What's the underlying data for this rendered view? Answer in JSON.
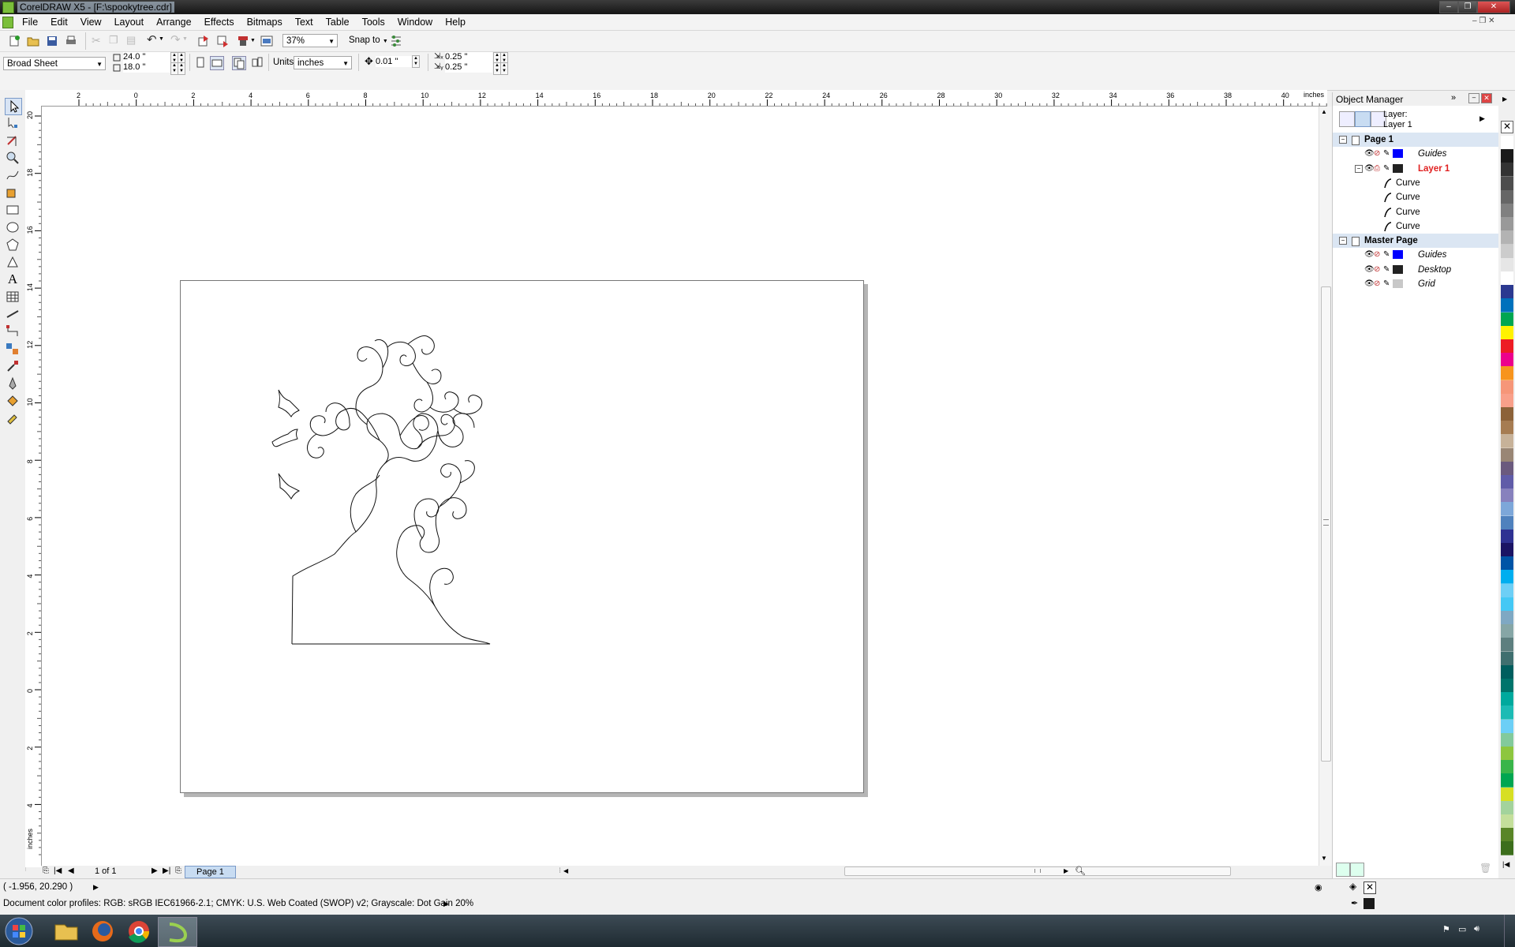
{
  "window": {
    "title": "CorelDRAW X5 - [F:\\spookytree.cdr]"
  },
  "menu": [
    "File",
    "Edit",
    "View",
    "Layout",
    "Arrange",
    "Effects",
    "Bitmaps",
    "Text",
    "Table",
    "Tools",
    "Window",
    "Help"
  ],
  "standard_toolbar": {
    "zoom": "37%",
    "snap_label": "Snap to"
  },
  "property_bar": {
    "paper_type": "Broad Sheet",
    "width": "24.0 \"",
    "height": "18.0 \"",
    "units_label": "Units:",
    "units": "inches",
    "nudge": "0.01 \"",
    "dup_x": "0.25 \"",
    "dup_y": "0.25 \""
  },
  "ruler": {
    "unit": "inches",
    "h_ticks": [
      "2",
      "0",
      "2",
      "4",
      "6",
      "8",
      "10",
      "12",
      "14",
      "16",
      "18",
      "20",
      "22",
      "24",
      "26",
      "28",
      "30",
      "32",
      "34",
      "36",
      "38",
      "40"
    ],
    "v_ticks": [
      "20",
      "18",
      "16",
      "14",
      "12",
      "10",
      "8",
      "6",
      "4",
      "2",
      "0",
      "2",
      "4"
    ],
    "v_unit": "inches"
  },
  "page_nav": {
    "counter": "1 of 1",
    "tab": "Page 1"
  },
  "object_manager": {
    "title": "Object Manager",
    "layer_label": "Layer:",
    "layer_value": "Layer 1",
    "rows": [
      {
        "label": "Page 1",
        "kind": "page"
      },
      {
        "label": "Guides",
        "kind": "layer",
        "color": "#0000ff",
        "style": "italic"
      },
      {
        "label": "Layer 1",
        "kind": "layer",
        "color": "#222222",
        "style": "active"
      },
      {
        "label": "Curve",
        "kind": "object"
      },
      {
        "label": "Curve",
        "kind": "object"
      },
      {
        "label": "Curve",
        "kind": "object"
      },
      {
        "label": "Curve",
        "kind": "object"
      },
      {
        "label": "Master Page",
        "kind": "page"
      },
      {
        "label": "Guides",
        "kind": "layer",
        "color": "#0000ff",
        "style": "italic"
      },
      {
        "label": "Desktop",
        "kind": "layer",
        "color": "#222222",
        "style": "italic"
      },
      {
        "label": "Grid",
        "kind": "layer",
        "color": "#c8c8c8",
        "style": "italic"
      }
    ]
  },
  "status": {
    "coords": "( -1.956, 20.290 )",
    "profiles": "Document color profiles: RGB: sRGB IEC61966-2.1; CMYK: U.S. Web Coated (SWOP) v2; Grayscale: Dot Gain 20%"
  },
  "palette": [
    "#ffffff",
    "#1a1a1a",
    "#333333",
    "#4d4d4d",
    "#666666",
    "#808080",
    "#999999",
    "#b3b3b3",
    "#cccccc",
    "#e6e6e6",
    "#ffffff",
    "#2b3990",
    "#0071bc",
    "#00a651",
    "#fff200",
    "#ed1c24",
    "#ec008c",
    "#f7941d",
    "#f69679",
    "#f9a08a",
    "#8c6239",
    "#a67c52",
    "#c7b299",
    "#998675",
    "#6b5a7e",
    "#605ca8",
    "#8781bd",
    "#7da7d9",
    "#4f81bd",
    "#2e3192",
    "#1b1464",
    "#0054a6",
    "#00aeef",
    "#6dcff6",
    "#44c8f5",
    "#7fa8c3",
    "#86a6a6",
    "#5d7f7f",
    "#3f6f6f",
    "#005e5e",
    "#00746b",
    "#00a99d",
    "#1cbbb4",
    "#6ccff6",
    "#82ca9c",
    "#8dc63f",
    "#39b54a",
    "#00a651",
    "#d7df23",
    "#a3d39c",
    "#c4df9b",
    "#598527",
    "#3c6e1c"
  ],
  "colors": {
    "accent": "#0050d0",
    "layer_active": "#e02020"
  }
}
